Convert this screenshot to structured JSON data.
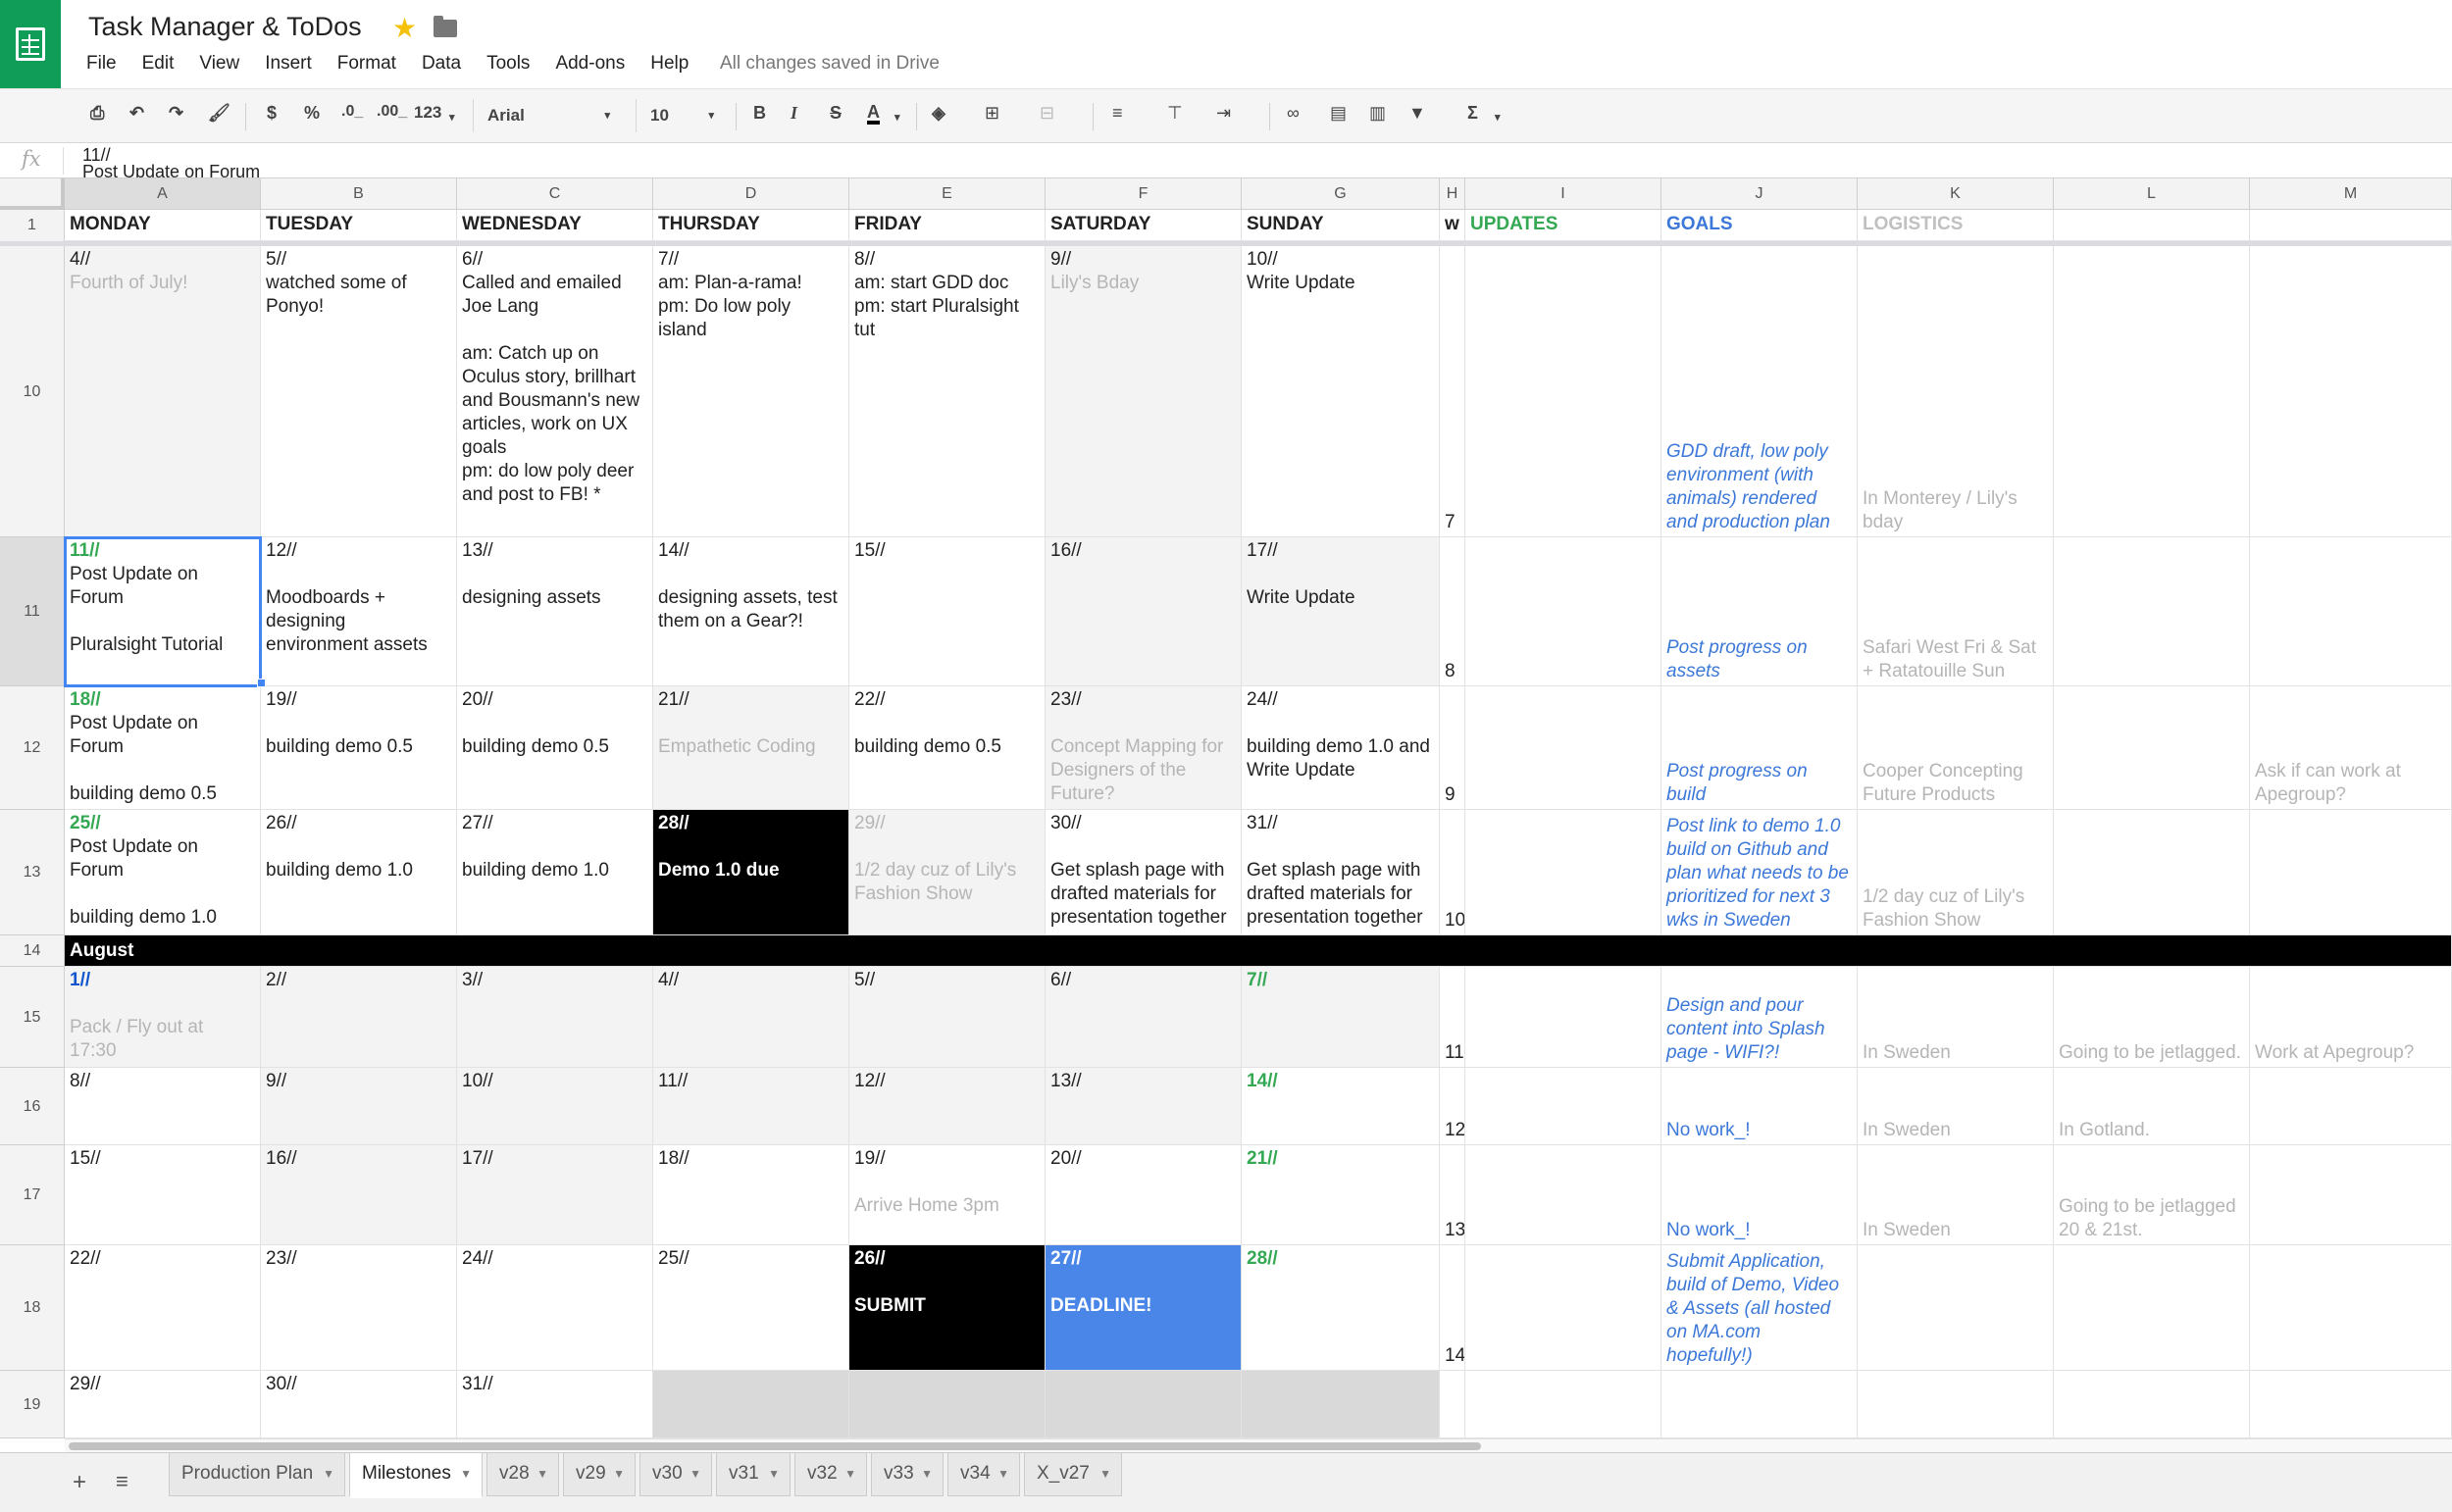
{
  "app": {
    "title": "Task Manager & ToDos",
    "saved_status": "All changes saved in Drive",
    "menu": [
      "File",
      "Edit",
      "View",
      "Insert",
      "Format",
      "Data",
      "Tools",
      "Add-ons",
      "Help"
    ]
  },
  "toolbar": {
    "currency": "$",
    "percent": "%",
    "dec_less": ".0_",
    "dec_more": ".00_",
    "number_format": "123",
    "font": "Arial",
    "size": "10",
    "bold": "B",
    "italic": "I",
    "strike": "S",
    "text_color": "A",
    "sum": "Σ"
  },
  "formula": {
    "fx": "fx",
    "value": "11//\nPost Update on Forum"
  },
  "columns": [
    "A",
    "B",
    "C",
    "D",
    "E",
    "F",
    "G",
    "H",
    "I",
    "J",
    "K",
    "L",
    "M"
  ],
  "header_row": {
    "num": "1",
    "cells": [
      "MONDAY",
      "TUESDAY",
      "WEDNESDAY",
      "THURSDAY",
      "FRIDAY",
      "SATURDAY",
      "SUNDAY",
      "w",
      "UPDATES",
      "GOALS",
      "LOGISTICS",
      "",
      ""
    ]
  },
  "rows": [
    {
      "num": "10",
      "cells": [
        {
          "day": "4//",
          "text": "Fourth of July!",
          "muted": true,
          "bg": "gray"
        },
        {
          "day": "5//",
          "text": "watched some of Ponyo!"
        },
        {
          "day": "6//",
          "text": "Called and emailed Joe Lang\n\nam: Catch up on Oculus story, brillhart and Bousmann's new articles, work on UX goals\npm: do low poly deer and post to FB! *"
        },
        {
          "day": "7//",
          "text": "am: Plan-a-rama!\npm: Do low poly island"
        },
        {
          "day": "8//",
          "text": "am: start GDD doc\npm: start Pluralsight tut"
        },
        {
          "day": "9//",
          "text": "Lily's Bday",
          "muted": true,
          "bg": "gray"
        },
        {
          "day": "10//",
          "text": "Write Update"
        },
        {
          "week": "7"
        },
        {
          "text": ""
        },
        {
          "goal": "GDD draft, low poly environment (with animals) rendered and production plan"
        },
        {
          "logistics": "In Monterey / Lily's bday"
        },
        {
          "text": ""
        },
        {
          "text": ""
        }
      ]
    },
    {
      "num": "11",
      "cells": [
        {
          "day": "11//",
          "day_style": "green",
          "text": "Post Update on Forum\n\nPluralsight Tutorial",
          "selected": true
        },
        {
          "day": "12//",
          "text": "\nMoodboards + designing environment assets"
        },
        {
          "day": "13//",
          "text": "\ndesigning assets"
        },
        {
          "day": "14//",
          "text": "\ndesigning assets, test them on a Gear?!"
        },
        {
          "day": "15//",
          "text": ""
        },
        {
          "day": "16//",
          "text": "",
          "bg": "gray"
        },
        {
          "day": "17//",
          "text": "\nWrite Update",
          "bg": "gray"
        },
        {
          "week": "8"
        },
        {
          "text": ""
        },
        {
          "goal": "Post progress on assets"
        },
        {
          "logistics": "Safari West Fri & Sat + Ratatouille Sun"
        },
        {
          "text": ""
        },
        {
          "text": ""
        }
      ]
    },
    {
      "num": "12",
      "cells": [
        {
          "day": "18//",
          "day_style": "green",
          "text": "Post Update on Forum\n\nbuilding demo 0.5"
        },
        {
          "day": "19//",
          "text": "\nbuilding demo 0.5"
        },
        {
          "day": "20//",
          "text": "\nbuilding demo 0.5"
        },
        {
          "day": "21//",
          "text": "\nEmpathetic Coding",
          "muted": true,
          "bg": "gray"
        },
        {
          "day": "22//",
          "text": "\nbuilding demo 0.5"
        },
        {
          "day": "23//",
          "text": "\nConcept Mapping for Designers of the Future?",
          "muted": true,
          "bg": "gray"
        },
        {
          "day": "24//",
          "text": "\nbuilding demo 1.0 and Write Update"
        },
        {
          "week": "9"
        },
        {
          "text": ""
        },
        {
          "goal": "Post progress on build"
        },
        {
          "logistics": "Cooper Concepting Future Products"
        },
        {
          "text": ""
        },
        {
          "logistics": "Ask if can work at Apegroup?"
        }
      ]
    },
    {
      "num": "13",
      "cells": [
        {
          "day": "25//",
          "day_style": "green",
          "text": "Post Update on Forum\n\nbuilding demo 1.0"
        },
        {
          "day": "26//",
          "text": "\nbuilding demo 1.0"
        },
        {
          "day": "27//",
          "text": "\nbuilding demo 1.0"
        },
        {
          "day": "28//",
          "text": "\nDemo 1.0 due",
          "bg": "black"
        },
        {
          "day": "29//",
          "day_style": "muted",
          "text": "\n1/2 day cuz of Lily's Fashion Show",
          "muted": true,
          "bg": "gray"
        },
        {
          "day": "30//",
          "text": "\nGet splash page with drafted materials for presentation together"
        },
        {
          "day": "31//",
          "text": "\nGet splash page with drafted materials for presentation together"
        },
        {
          "week": "10"
        },
        {
          "text": ""
        },
        {
          "goal": "Post link to demo 1.0 build on Github and plan what needs to be prioritized for next 3 wks in Sweden"
        },
        {
          "logistics": "1/2 day cuz of Lily's Fashion Show"
        },
        {
          "text": ""
        },
        {
          "text": ""
        }
      ]
    },
    {
      "num": "14",
      "month": "August"
    },
    {
      "num": "15",
      "cells": [
        {
          "day": "1//",
          "day_style": "blue",
          "text": "\nPack / Fly out at 17:30",
          "muted": true,
          "bg": "gray"
        },
        {
          "day": "2//",
          "text": "",
          "bg": "gray"
        },
        {
          "day": "3//",
          "text": "",
          "bg": "gray"
        },
        {
          "day": "4//",
          "text": "",
          "bg": "gray"
        },
        {
          "day": "5//",
          "text": "",
          "bg": "gray"
        },
        {
          "day": "6//",
          "text": "",
          "bg": "gray"
        },
        {
          "day": "7//",
          "day_style": "green",
          "text": "",
          "bg": "gray"
        },
        {
          "week": "11"
        },
        {
          "text": ""
        },
        {
          "goal": "Design and pour content into Splash page - WIFI?!"
        },
        {
          "logistics": "In Sweden"
        },
        {
          "logistics": "Going to be jetlagged."
        },
        {
          "logistics": "Work at Apegroup?"
        }
      ]
    },
    {
      "num": "16",
      "cells": [
        {
          "day": "8//",
          "text": ""
        },
        {
          "day": "9//",
          "text": "",
          "bg": "gray"
        },
        {
          "day": "10//",
          "text": "",
          "bg": "gray"
        },
        {
          "day": "11//",
          "text": "",
          "bg": "gray"
        },
        {
          "day": "12//",
          "text": "",
          "bg": "gray"
        },
        {
          "day": "13//",
          "text": "",
          "bg": "gray"
        },
        {
          "day": "14//",
          "day_style": "green",
          "text": ""
        },
        {
          "week": "12"
        },
        {
          "text": ""
        },
        {
          "goal_plain": "No work_!"
        },
        {
          "logistics": "In Sweden"
        },
        {
          "logistics": "In Gotland."
        },
        {
          "text": ""
        }
      ]
    },
    {
      "num": "17",
      "cells": [
        {
          "day": "15//",
          "text": ""
        },
        {
          "day": "16//",
          "text": "",
          "bg": "gray"
        },
        {
          "day": "17//",
          "text": "",
          "bg": "gray"
        },
        {
          "day": "18//",
          "text": ""
        },
        {
          "day": "19//",
          "text": "\nArrive Home 3pm",
          "muted": true
        },
        {
          "day": "20//",
          "text": ""
        },
        {
          "day": "21//",
          "day_style": "green",
          "text": ""
        },
        {
          "week": "13"
        },
        {
          "text": ""
        },
        {
          "goal_plain": "No work_!"
        },
        {
          "logistics": "In Sweden"
        },
        {
          "logistics": "Going to be jetlagged 20 & 21st."
        },
        {
          "text": ""
        }
      ]
    },
    {
      "num": "18",
      "cells": [
        {
          "day": "22//",
          "text": ""
        },
        {
          "day": "23//",
          "text": ""
        },
        {
          "day": "24//",
          "text": ""
        },
        {
          "day": "25//",
          "text": ""
        },
        {
          "day": "26//",
          "text": "\nSUBMIT",
          "bg": "black"
        },
        {
          "day": "27//",
          "text": "\nDEADLINE!",
          "bg": "blue"
        },
        {
          "day": "28//",
          "day_style": "green",
          "text": ""
        },
        {
          "week": "14"
        },
        {
          "text": ""
        },
        {
          "goal": "Submit Application, build of Demo, Video & Assets (all hosted on MA.com hopefully!)"
        },
        {
          "text": ""
        },
        {
          "text": ""
        },
        {
          "text": ""
        }
      ]
    },
    {
      "num": "19",
      "cells": [
        {
          "day": "29//",
          "text": ""
        },
        {
          "day": "30//",
          "text": ""
        },
        {
          "day": "31//",
          "text": ""
        },
        {
          "day": "",
          "text": "",
          "bg": "darkgray"
        },
        {
          "day": "",
          "text": "",
          "bg": "darkgray"
        },
        {
          "day": "",
          "text": "",
          "bg": "darkgray"
        },
        {
          "day": "",
          "text": "",
          "bg": "darkgray"
        },
        {
          "week": ""
        },
        {
          "text": ""
        },
        {
          "text": ""
        },
        {
          "text": ""
        },
        {
          "text": ""
        },
        {
          "text": ""
        }
      ]
    }
  ],
  "tabs": [
    {
      "label": "Production Plan"
    },
    {
      "label": "Milestones",
      "active": true
    },
    {
      "label": "v28"
    },
    {
      "label": "v29"
    },
    {
      "label": "v30"
    },
    {
      "label": "v31"
    },
    {
      "label": "v32"
    },
    {
      "label": "v33"
    },
    {
      "label": "v34"
    },
    {
      "label": "X_v27"
    }
  ],
  "tab_controls": {
    "add": "+",
    "list": "≡"
  },
  "colors": {
    "brand": "#0f9d58",
    "selection": "#4285f4",
    "updates": "#34a853",
    "goals": "#3c78d8",
    "deadline": "#4a86e8"
  }
}
